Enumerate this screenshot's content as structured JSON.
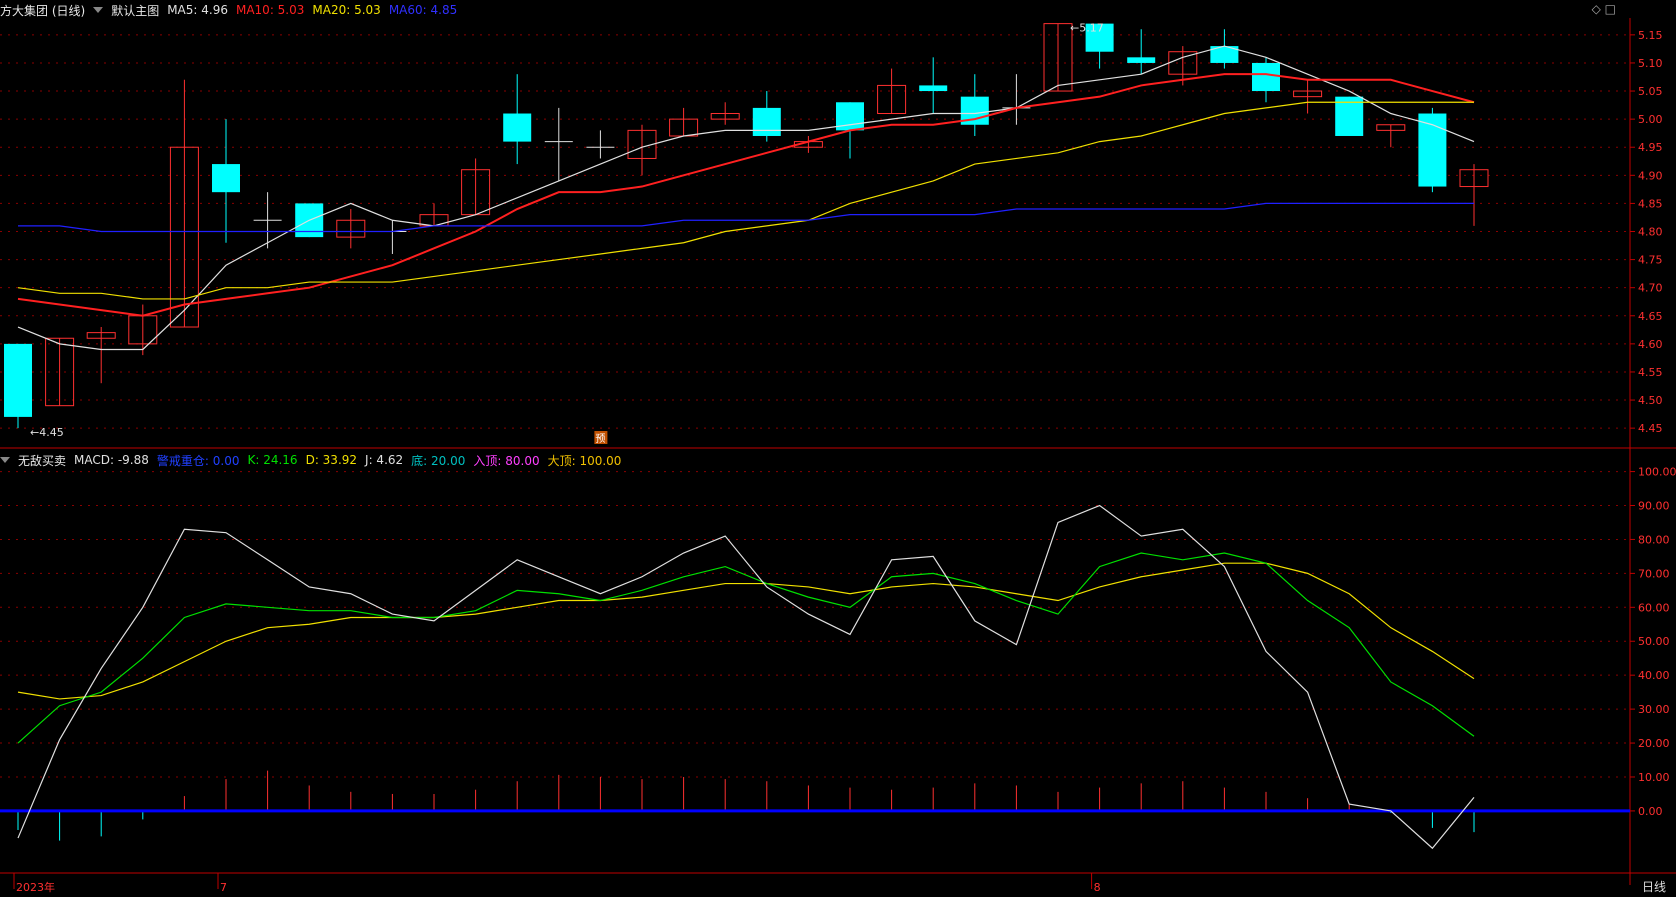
{
  "main_header": {
    "title": "方大集团 (日线)",
    "subtitle": "默认主图",
    "ma": [
      {
        "label": "MA5: 4.96",
        "color": "#e0e0e0"
      },
      {
        "label": "MA10: 5.03",
        "color": "#ff2020"
      },
      {
        "label": "MA20: 5.03",
        "color": "#f0e000"
      },
      {
        "label": "MA60: 4.85",
        "color": "#2020ff"
      }
    ]
  },
  "indicator_header": {
    "title": "无敌买卖",
    "items": [
      {
        "label": "MACD: -9.88",
        "color": "#e0e0e0"
      },
      {
        "label": "警戒重仓: 0.00",
        "color": "#2040ff"
      },
      {
        "label": "K: 24.16",
        "color": "#00e000"
      },
      {
        "label": "D: 33.92",
        "color": "#f0e000"
      },
      {
        "label": "J: 4.62",
        "color": "#e0e0e0"
      },
      {
        "label": "底: 20.00",
        "color": "#00c0c0"
      },
      {
        "label": "入顶: 80.00",
        "color": "#ff40ff"
      },
      {
        "label": "大顶: 100.00",
        "color": "#f0c000"
      }
    ]
  },
  "corner_buttons": "◇ □",
  "period": "日线",
  "x_labels": [
    {
      "text": "2023年",
      "index": 0
    },
    {
      "text": "7",
      "index": 5
    },
    {
      "text": "8",
      "index": 26
    }
  ],
  "marker_label": "预",
  "colors": {
    "up": "#ff3030",
    "down": "#00ffff",
    "grid": "#8a0000",
    "axis": "#c00000",
    "ma5": "#e0e0e0",
    "ma10": "#ff2020",
    "ma20": "#f0e000",
    "ma60": "#2020ff",
    "k": "#00e000",
    "d": "#f0e000",
    "j": "#e0e0e0",
    "zero": "#0000ff"
  },
  "chart_data": [
    {
      "type": "candlestick",
      "ylim": [
        4.42,
        5.18
      ],
      "y_ticks": [
        "4.45",
        "4.50",
        "4.55",
        "4.60",
        "4.65",
        "4.70",
        "4.75",
        "4.80",
        "4.85",
        "4.90",
        "4.95",
        "5.00",
        "5.05",
        "5.10",
        "5.15"
      ],
      "annotations": [
        {
          "text": "5.17",
          "index": 25,
          "value": 5.17
        },
        {
          "text": "4.45",
          "index": 0,
          "value": 4.45
        }
      ],
      "candles": [
        {
          "o": 4.6,
          "h": 4.6,
          "l": 4.45,
          "c": 4.47
        },
        {
          "o": 4.49,
          "h": 4.61,
          "l": 4.49,
          "c": 4.61
        },
        {
          "o": 4.61,
          "h": 4.63,
          "l": 4.53,
          "c": 4.62
        },
        {
          "o": 4.6,
          "h": 4.67,
          "l": 4.58,
          "c": 4.65
        },
        {
          "o": 4.63,
          "h": 5.07,
          "l": 4.63,
          "c": 4.95
        },
        {
          "o": 4.92,
          "h": 5.0,
          "l": 4.78,
          "c": 4.87
        },
        {
          "o": 4.82,
          "h": 4.87,
          "l": 4.77,
          "c": 4.82
        },
        {
          "o": 4.85,
          "h": 4.85,
          "l": 4.79,
          "c": 4.79
        },
        {
          "o": 4.79,
          "h": 4.84,
          "l": 4.77,
          "c": 4.82
        },
        {
          "o": 4.8,
          "h": 4.82,
          "l": 4.76,
          "c": 4.8
        },
        {
          "o": 4.81,
          "h": 4.85,
          "l": 4.81,
          "c": 4.83
        },
        {
          "o": 4.83,
          "h": 4.93,
          "l": 4.83,
          "c": 4.91
        },
        {
          "o": 5.01,
          "h": 5.08,
          "l": 4.92,
          "c": 4.96
        },
        {
          "o": 4.96,
          "h": 5.02,
          "l": 4.89,
          "c": 4.96
        },
        {
          "o": 4.95,
          "h": 4.98,
          "l": 4.93,
          "c": 4.95
        },
        {
          "o": 4.93,
          "h": 4.99,
          "l": 4.9,
          "c": 4.98
        },
        {
          "o": 4.97,
          "h": 5.02,
          "l": 4.97,
          "c": 5.0
        },
        {
          "o": 5.0,
          "h": 5.03,
          "l": 4.99,
          "c": 5.01
        },
        {
          "o": 5.02,
          "h": 5.05,
          "l": 4.96,
          "c": 4.97
        },
        {
          "o": 4.95,
          "h": 4.97,
          "l": 4.94,
          "c": 4.96
        },
        {
          "o": 5.03,
          "h": 5.03,
          "l": 4.93,
          "c": 4.98
        },
        {
          "o": 5.01,
          "h": 5.09,
          "l": 5.01,
          "c": 5.06
        },
        {
          "o": 5.06,
          "h": 5.11,
          "l": 5.01,
          "c": 5.05
        },
        {
          "o": 5.04,
          "h": 5.08,
          "l": 4.97,
          "c": 4.99
        },
        {
          "o": 5.02,
          "h": 5.08,
          "l": 4.99,
          "c": 5.02
        },
        {
          "o": 5.05,
          "h": 5.17,
          "l": 5.05,
          "c": 5.17
        },
        {
          "o": 5.17,
          "h": 5.17,
          "l": 5.09,
          "c": 5.12
        },
        {
          "o": 5.11,
          "h": 5.16,
          "l": 5.08,
          "c": 5.1
        },
        {
          "o": 5.08,
          "h": 5.13,
          "l": 5.06,
          "c": 5.12
        },
        {
          "o": 5.13,
          "h": 5.16,
          "l": 5.09,
          "c": 5.1
        },
        {
          "o": 5.1,
          "h": 5.11,
          "l": 5.03,
          "c": 5.05
        },
        {
          "o": 5.04,
          "h": 5.07,
          "l": 5.01,
          "c": 5.05
        },
        {
          "o": 5.04,
          "h": 5.04,
          "l": 4.97,
          "c": 4.97
        },
        {
          "o": 4.98,
          "h": 4.99,
          "l": 4.95,
          "c": 4.99
        },
        {
          "o": 5.01,
          "h": 5.02,
          "l": 4.87,
          "c": 4.88
        },
        {
          "o": 4.88,
          "h": 4.92,
          "l": 4.81,
          "c": 4.91
        }
      ],
      "ma5": [
        4.63,
        4.6,
        4.59,
        4.59,
        4.66,
        4.74,
        4.78,
        4.82,
        4.85,
        4.82,
        4.81,
        4.83,
        4.86,
        4.89,
        4.92,
        4.95,
        4.97,
        4.98,
        4.98,
        4.98,
        4.99,
        5.0,
        5.01,
        5.01,
        5.02,
        5.06,
        5.07,
        5.08,
        5.11,
        5.13,
        5.11,
        5.08,
        5.05,
        5.01,
        4.99,
        4.96
      ],
      "ma10": [
        4.68,
        4.67,
        4.66,
        4.65,
        4.67,
        4.68,
        4.69,
        4.7,
        4.72,
        4.74,
        4.77,
        4.8,
        4.84,
        4.87,
        4.87,
        4.88,
        4.9,
        4.92,
        4.94,
        4.96,
        4.98,
        4.99,
        4.99,
        5.0,
        5.02,
        5.03,
        5.04,
        5.06,
        5.07,
        5.08,
        5.08,
        5.07,
        5.07,
        5.07,
        5.05,
        5.03
      ],
      "ma20": [
        4.7,
        4.69,
        4.69,
        4.68,
        4.68,
        4.7,
        4.7,
        4.71,
        4.71,
        4.71,
        4.72,
        4.73,
        4.74,
        4.75,
        4.76,
        4.77,
        4.78,
        4.8,
        4.81,
        4.82,
        4.85,
        4.87,
        4.89,
        4.92,
        4.93,
        4.94,
        4.96,
        4.97,
        4.99,
        5.01,
        5.02,
        5.03,
        5.03,
        5.03,
        5.03,
        5.03
      ],
      "ma60": [
        4.81,
        4.81,
        4.8,
        4.8,
        4.8,
        4.8,
        4.8,
        4.8,
        4.8,
        4.8,
        4.81,
        4.81,
        4.81,
        4.81,
        4.81,
        4.81,
        4.82,
        4.82,
        4.82,
        4.82,
        4.83,
        4.83,
        4.83,
        4.83,
        4.84,
        4.84,
        4.84,
        4.84,
        4.84,
        4.84,
        4.85,
        4.85,
        4.85,
        4.85,
        4.85,
        4.85
      ]
    },
    {
      "type": "line",
      "ylim": [
        -18,
        104
      ],
      "y_ticks": [
        "0.00",
        "10.00",
        "20.00",
        "30.00",
        "40.00",
        "50.00",
        "60.00",
        "70.00",
        "80.00",
        "90.00",
        "100.00"
      ],
      "series": [
        {
          "name": "K",
          "values": [
            20,
            31,
            35,
            45,
            57,
            61,
            60,
            59,
            59,
            57,
            57,
            59,
            65,
            64,
            62,
            65,
            69,
            72,
            67,
            63,
            60,
            69,
            70,
            67,
            62,
            58,
            72,
            76,
            74,
            76,
            73,
            62,
            54,
            38,
            31,
            22,
            24
          ]
        },
        {
          "name": "D",
          "values": [
            35,
            33,
            34,
            38,
            44,
            50,
            54,
            55,
            57,
            57,
            57,
            58,
            60,
            62,
            62,
            63,
            65,
            67,
            67,
            66,
            64,
            66,
            67,
            66,
            64,
            62,
            66,
            69,
            71,
            73,
            73,
            70,
            64,
            54,
            47,
            39,
            34
          ]
        },
        {
          "name": "J",
          "values": [
            -8,
            21,
            42,
            60,
            83,
            82,
            74,
            66,
            64,
            58,
            56,
            65,
            74,
            69,
            64,
            69,
            76,
            81,
            66,
            58,
            52,
            74,
            75,
            56,
            49,
            85,
            90,
            81,
            83,
            72,
            47,
            35,
            2,
            0,
            -11,
            4
          ]
        },
        {
          "name": "MACD",
          "values": [
            -9,
            -14,
            -12,
            -4,
            7,
            15,
            19,
            12,
            9,
            8,
            8,
            10,
            14,
            17,
            16,
            15,
            16,
            15,
            14,
            12,
            11,
            10,
            11,
            13,
            12,
            9,
            11,
            13,
            14,
            11,
            9,
            6,
            3,
            -1,
            -8,
            -10,
            -9.88
          ]
        }
      ]
    }
  ]
}
